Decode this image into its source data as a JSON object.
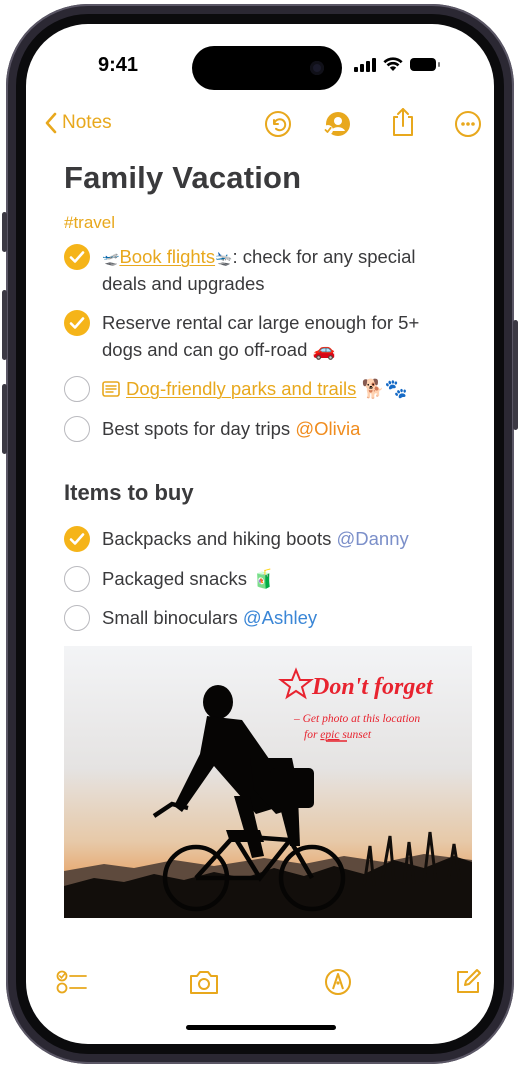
{
  "status_bar": {
    "time": "9:41"
  },
  "nav": {
    "back_label": "Notes"
  },
  "note": {
    "title": "Family Vacation",
    "tag": "#travel",
    "checklist": [
      {
        "checked": true,
        "emoji_before": "🛫",
        "link": "Book flights",
        "emoji_after": "🛬",
        "text": ": check for any special",
        "text2": "deals and upgrades"
      },
      {
        "checked": true,
        "text": "Reserve rental car large enough for 5+",
        "text2": "dogs and can go off-road",
        "emoji_after": "🚗"
      },
      {
        "checked": false,
        "link": "Dog-friendly parks and trails",
        "emoji_after": "🐕🐾"
      },
      {
        "checked": false,
        "text": "Best spots for day trips ",
        "mention": "@Olivia"
      }
    ],
    "section_heading": "Items to buy",
    "buy_list": [
      {
        "checked": true,
        "text": "Backpacks and hiking boots ",
        "mention": "@Danny"
      },
      {
        "checked": false,
        "text": "Packaged snacks ",
        "emoji_after": "🧃"
      },
      {
        "checked": false,
        "text": "Small binoculars ",
        "mention": "@Ashley"
      }
    ],
    "photo": {
      "handwriting_title": "Don't forget",
      "handwriting_line1": "– Get photo at this location",
      "handwriting_line2_pre": "for ",
      "handwriting_line2_emph": "epic",
      "handwriting_line2_post": " sunset"
    }
  },
  "colors": {
    "accent": "#e8a81d",
    "check_fill": "#f5b419",
    "handwriting": "#e8232f",
    "mention_orange": "#f08c1e",
    "mention_blue": "#3a86d6"
  }
}
